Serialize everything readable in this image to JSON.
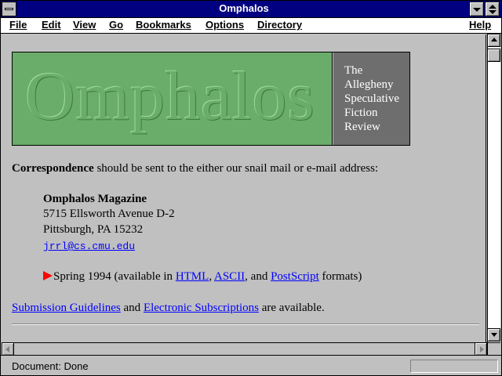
{
  "window": {
    "title": "Omphalos"
  },
  "menu": {
    "file": "File",
    "edit": "Edit",
    "view": "View",
    "go": "Go",
    "bookmarks": "Bookmarks",
    "options": "Options",
    "directory": "Directory",
    "help": "Help"
  },
  "banner": {
    "word": "Omphalos",
    "line1": "The",
    "line2": "Allegheny",
    "line3": "Speculative",
    "line4": "Fiction",
    "line5": "Review",
    "green_color": "#6aad6a",
    "gray_color": "#6e6e6e"
  },
  "correspondence": {
    "bold": "Correspondence",
    "text": " should be sent to the either our snail mail or e-mail address:"
  },
  "address": {
    "name": "Omphalos Magazine",
    "street": "5715 Ellsworth Avenue D-2",
    "city": "Pittsburgh, PA 15232",
    "email": "jrrl@cs.cmu.edu"
  },
  "issue": {
    "prefix": "Spring 1994 (available in ",
    "html": "HTML",
    "sep1": ", ",
    "ascii": "ASCII",
    "sep2": ", and ",
    "postscript": "PostScript",
    "suffix": " formats)",
    "arrow_icon": "red-arrow-icon"
  },
  "footer_links": {
    "submission": "Submission Guidelines",
    "and": " and ",
    "subscriptions": "Electronic Subscriptions",
    "tail": " are available."
  },
  "status": {
    "text": "Document: Done"
  },
  "colors": {
    "titlebar": "#000080",
    "link": "#0000ff",
    "chrome": "#c0c0c0"
  }
}
